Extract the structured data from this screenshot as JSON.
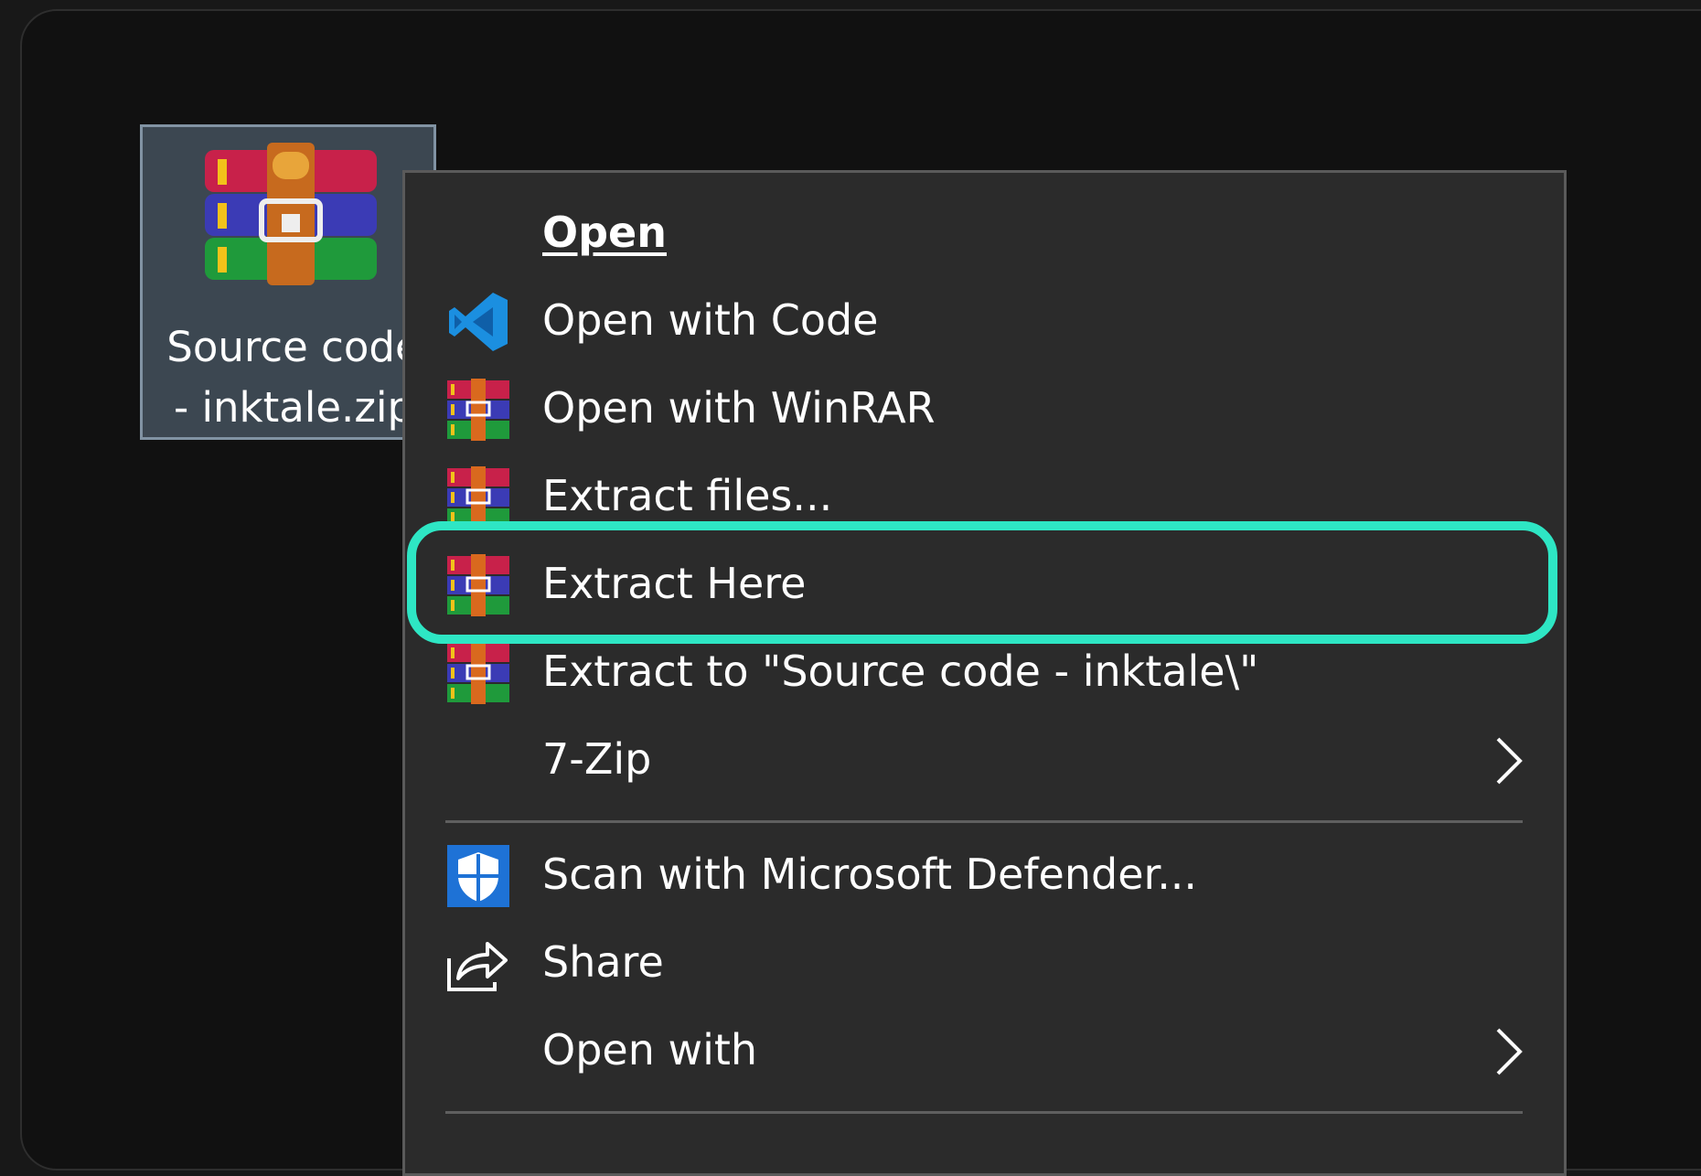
{
  "desktop": {
    "file": {
      "name_line1": "Source code",
      "name_line2": "- inktale.zip",
      "icon": "winrar-archive-icon"
    }
  },
  "context_menu": {
    "items": [
      {
        "label": "Open",
        "icon": null
      },
      {
        "label": "Open with Code",
        "icon": "vscode-icon"
      },
      {
        "label": "Open with WinRAR",
        "icon": "winrar-icon"
      },
      {
        "label": "Extract files...",
        "icon": "winrar-icon"
      },
      {
        "label": "Extract Here",
        "icon": "winrar-icon",
        "highlighted": true
      },
      {
        "label": "Extract to \"Source code - inktale\\\"",
        "icon": "winrar-icon"
      },
      {
        "label": "7-Zip",
        "icon": null,
        "submenu": true
      },
      {
        "label": "Scan with Microsoft Defender...",
        "icon": "defender-shield-icon"
      },
      {
        "label": "Share",
        "icon": "share-icon"
      },
      {
        "label": "Open with",
        "icon": null,
        "submenu": true
      }
    ]
  },
  "colors": {
    "highlight": "#2ee6c4",
    "menu_background": "#2b2b2b",
    "selection": "#3c4751"
  }
}
